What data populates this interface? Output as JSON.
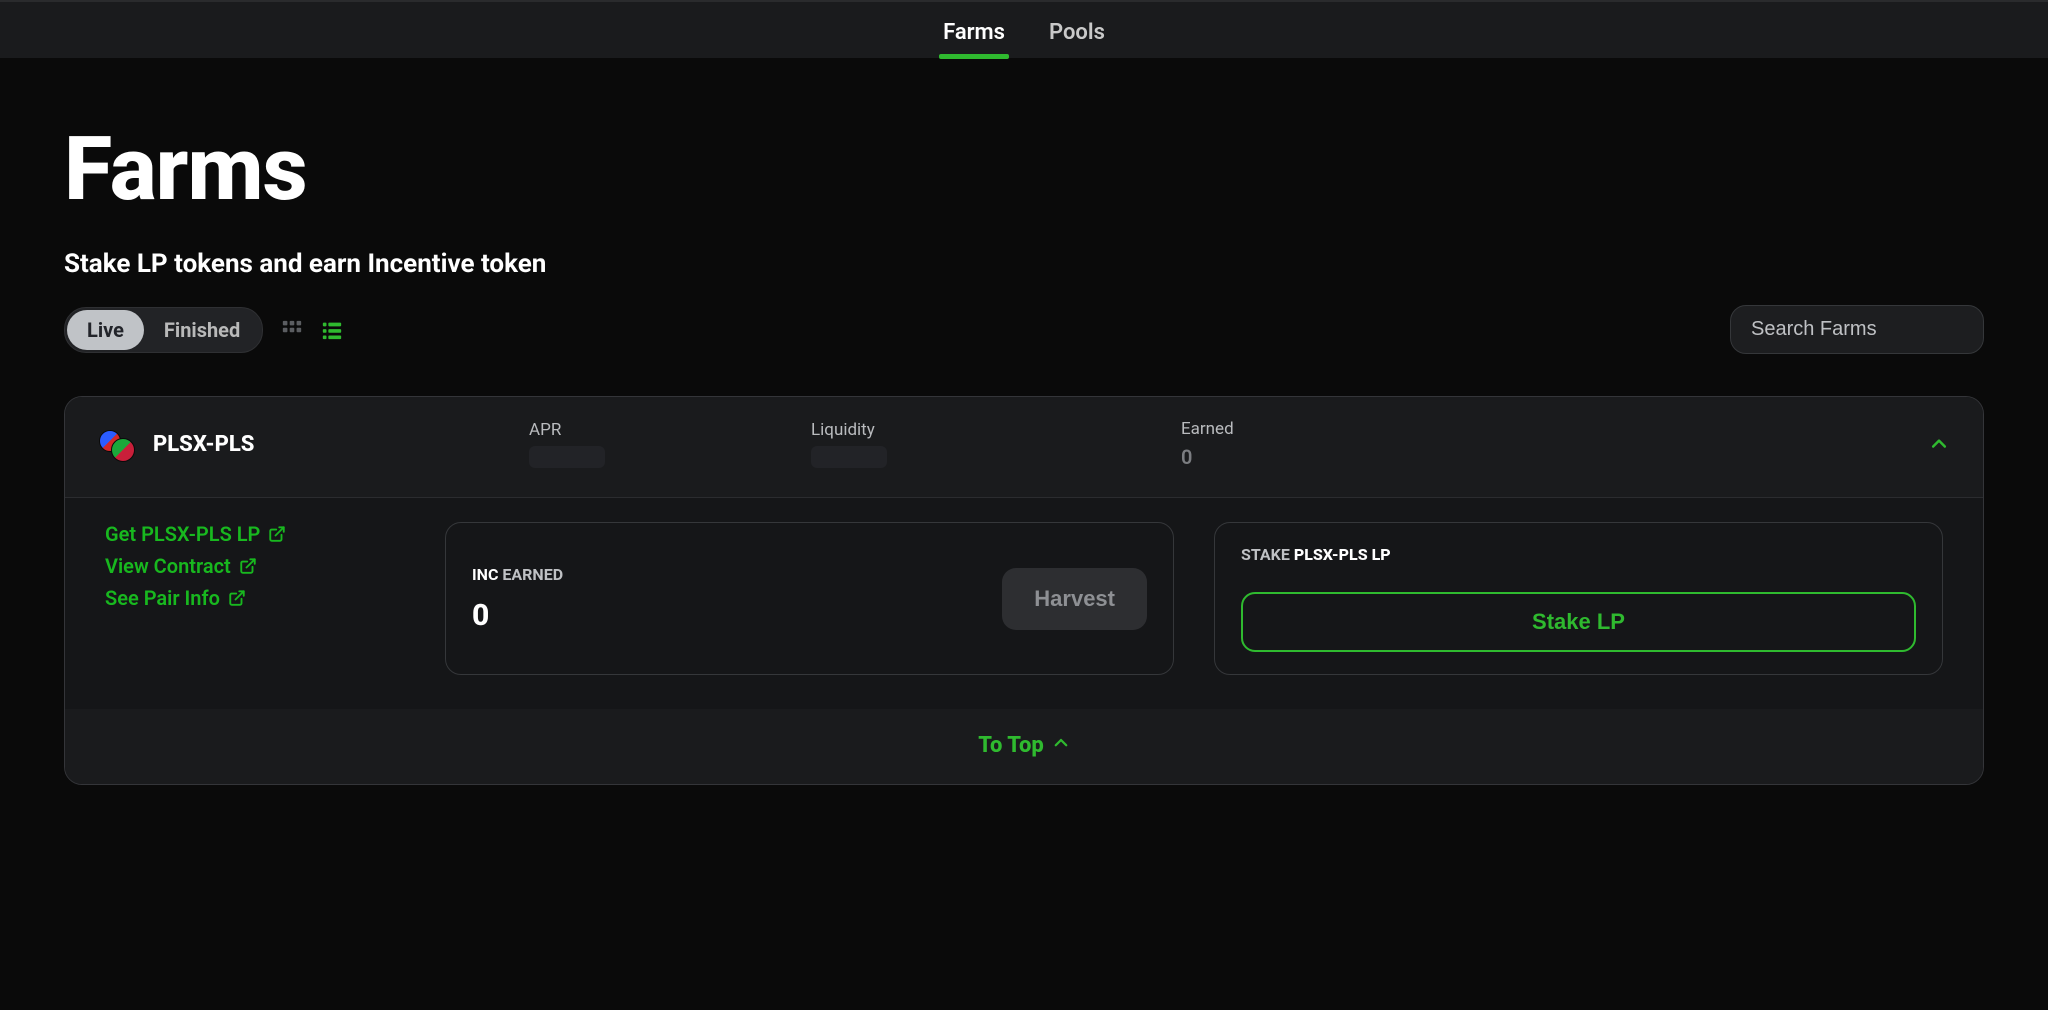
{
  "nav": {
    "tabs": [
      {
        "label": "Farms",
        "active": true
      },
      {
        "label": "Pools",
        "active": false
      }
    ]
  },
  "header": {
    "title": "Farms",
    "subtitle": "Stake LP tokens and earn Incentive token"
  },
  "filters": {
    "pills": [
      {
        "label": "Live",
        "active": true
      },
      {
        "label": "Finished",
        "active": false
      }
    ],
    "search_placeholder": "Search Farms"
  },
  "farm": {
    "pair_name": "PLSX-PLS",
    "metrics": {
      "apr_label": "APR",
      "liq_label": "Liquidity",
      "earned_label": "Earned",
      "earned_value": "0"
    },
    "links": {
      "get_lp": "Get PLSX-PLS LP",
      "view_contract": "View Contract",
      "see_pair": "See Pair Info"
    },
    "earned_box": {
      "token": "INC",
      "label": "EARNED",
      "value": "0",
      "harvest_label": "Harvest"
    },
    "stake_box": {
      "prefix": "STAKE",
      "lp_name": "PLSX-PLS LP",
      "button_label": "Stake LP"
    }
  },
  "footer": {
    "to_top": "To Top"
  },
  "colors": {
    "accent_green": "#2fba2f"
  }
}
